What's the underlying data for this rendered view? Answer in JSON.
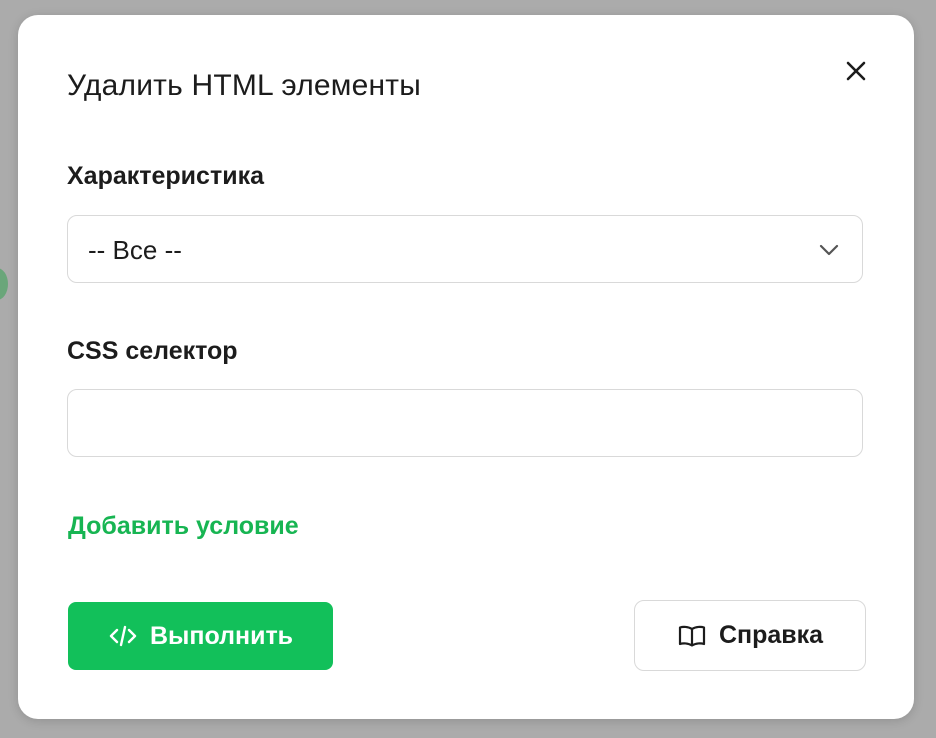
{
  "modal": {
    "title": "Удалить HTML элементы",
    "close_icon": "close-icon"
  },
  "characteristic": {
    "label": "Характеристика",
    "selected": "-- Все --",
    "chevron_icon": "chevron-down-icon"
  },
  "css_selector": {
    "label": "CSS селектор",
    "value": "",
    "placeholder": ""
  },
  "add_condition": {
    "label": "Добавить условие"
  },
  "actions": {
    "run_label": "Выполнить",
    "run_icon": "code-icon",
    "help_label": "Справка",
    "help_icon": "book-icon"
  },
  "colors": {
    "accent": "#12c05a",
    "link": "#17b552",
    "overlay": "#a9a9a9"
  }
}
